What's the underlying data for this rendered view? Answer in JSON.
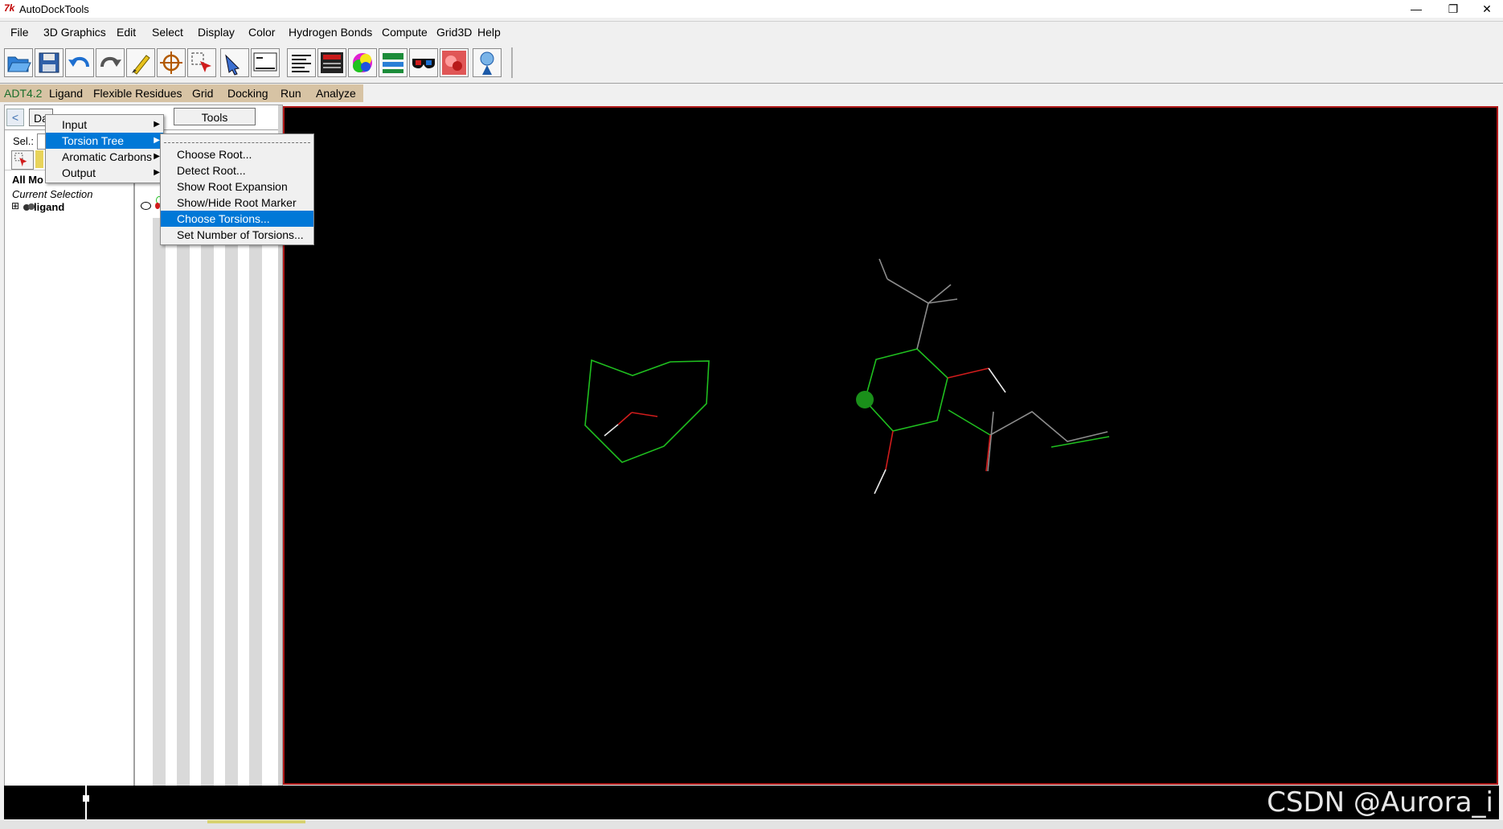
{
  "window": {
    "title": "AutoDockTools",
    "icon_text": "7k",
    "controls": {
      "minimize": "—",
      "maximize": "❐",
      "close": "✕"
    }
  },
  "menubar": [
    "File",
    "3D Graphics",
    "Edit",
    "Select",
    "Display",
    "Color",
    "Hydrogen Bonds",
    "Compute",
    "Grid3D",
    "Help"
  ],
  "toolbar_icons": [
    "open-folder-icon",
    "save-icon",
    "undo-icon",
    "redo-icon",
    "paint-icon",
    "crosshair-icon",
    "select-icon",
    "pick-icon",
    "python-shell-icon",
    "text-icon",
    "panel-icon",
    "color-cube-icon",
    "graph-icon",
    "stereo-glasses-icon",
    "molecule-icon",
    "tutorial-icon"
  ],
  "plugin_bar": {
    "version": "ADT4.2",
    "items": [
      "Ligand",
      "Flexible Residues",
      "Grid",
      "Docking",
      "Run",
      "Analyze"
    ]
  },
  "dashboard": {
    "tab_partial": "Da",
    "tools_tab": "Tools",
    "sel_label": "Sel.:",
    "all_molecules": "All Mo",
    "current_selection": "Current Selection",
    "ligand_node": "ligand",
    "expand_symbol": "⊞"
  },
  "ligand_menu": {
    "items": [
      {
        "label": "Input",
        "has_submenu": true,
        "selected": false
      },
      {
        "label": "Torsion Tree",
        "has_submenu": true,
        "selected": true
      },
      {
        "label": "Aromatic Carbons",
        "has_submenu": true,
        "selected": false
      },
      {
        "label": "Output",
        "has_submenu": true,
        "selected": false
      }
    ]
  },
  "torsion_submenu": {
    "items": [
      {
        "label": "Choose Root...",
        "selected": false
      },
      {
        "label": "Detect Root...",
        "selected": false
      },
      {
        "label": "Show Root Expansion",
        "selected": false
      },
      {
        "label": "Show/Hide Root Marker",
        "selected": false
      },
      {
        "label": "Choose Torsions...",
        "selected": true
      },
      {
        "label": "Set Number of Torsions...",
        "selected": false
      }
    ]
  },
  "watermark": "CSDN @Aurora_i",
  "colors": {
    "plugin_bar": "#d7c3a4",
    "menu_highlight": "#0078d7",
    "viewer_background": "#000000",
    "viewer_border": "#b01818",
    "carbon_bond": "#1fbf1f",
    "oxygen_bond": "#d01c1c",
    "hydrogen_bond": "#e8e8e8",
    "root_marker": "#1a8f1a"
  }
}
